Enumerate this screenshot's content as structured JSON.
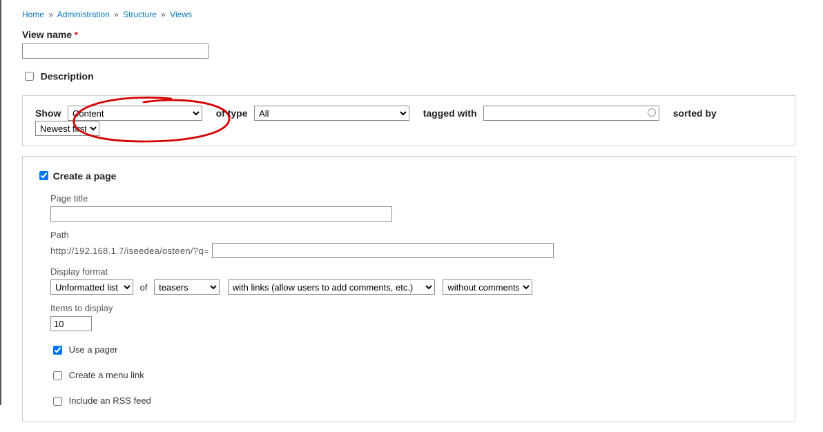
{
  "breadcrumb": {
    "items": [
      "Home",
      "Administration",
      "Structure",
      "Views"
    ],
    "separator": "»"
  },
  "viewName": {
    "label": "View name",
    "required": "*",
    "value": ""
  },
  "description": {
    "label": "Description",
    "checked": false
  },
  "showRow": {
    "showLabel": "Show",
    "content": "Content",
    "ofTypeLabel": "of type",
    "ofType": "All",
    "taggedWithLabel": "tagged with",
    "taggedWith": "",
    "sortedByLabel": "sorted by",
    "sortedBy": "Newest first"
  },
  "createPage": {
    "label": "Create a page",
    "checked": true,
    "pageTitleLabel": "Page title",
    "pageTitle": "",
    "pathLabel": "Path",
    "pathPrefix": "http://192.168.1.7/iseedea/osteen/?q=",
    "path": "",
    "displayFormatLabel": "Display format",
    "format1": "Unformatted list",
    "ofText": "of",
    "format2": "teasers",
    "format3": "with links (allow users to add comments, etc.)",
    "format4": "without comments",
    "itemsLabel": "Items to display",
    "items": "10",
    "usePager": {
      "label": "Use a pager",
      "checked": true
    },
    "createMenu": {
      "label": "Create a menu link",
      "checked": false
    },
    "includeRss": {
      "label": "Include an RSS feed",
      "checked": false
    }
  }
}
